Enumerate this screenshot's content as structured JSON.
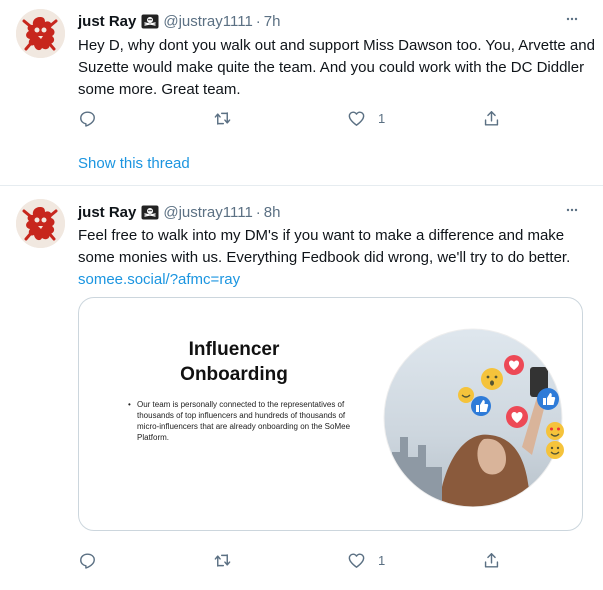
{
  "tweets": [
    {
      "name": "just Ray",
      "handle": "@justray1111",
      "separator": "·",
      "time": "7h",
      "text": "Hey D, why dont you walk out and support Miss Dawson too. You, Arvette and Suzette would make quite the team. And you could work with the DC Diddler some more. Great team.",
      "actions": {
        "reply": "",
        "retweet": "",
        "like": "1",
        "share": ""
      },
      "show_thread": "Show this thread"
    },
    {
      "name": "just Ray",
      "handle": "@justray1111",
      "separator": "·",
      "time": "8h",
      "text": "Feel free to walk into my DM's if you want to make a difference and make some monies with us. Everything Fedbook did wrong, we'll try to do better. ",
      "link": "somee.social/?afmc=ray",
      "card": {
        "title_line1": "Influencer",
        "title_line2": "Onboarding",
        "bullet": "Our team is personally connected to the representatives of thousands of top influencers and hundreds of thousands of micro-influencers that are already onboarding on the SoMee Platform."
      },
      "actions": {
        "reply": "",
        "retweet": "",
        "like": "1",
        "share": ""
      }
    }
  ],
  "icons": {
    "avatar": "pirate-flag-avatar",
    "badge": "pirate-flag-icon",
    "more": "more-icon",
    "reply": "reply-icon",
    "retweet": "retweet-icon",
    "like": "heart-icon",
    "share": "share-icon"
  },
  "colors": {
    "text": "#0f1419",
    "secondary": "#5b7083",
    "link": "#1b95e0",
    "border": "#e6ecf0",
    "avatar_red": "#c7261d"
  }
}
